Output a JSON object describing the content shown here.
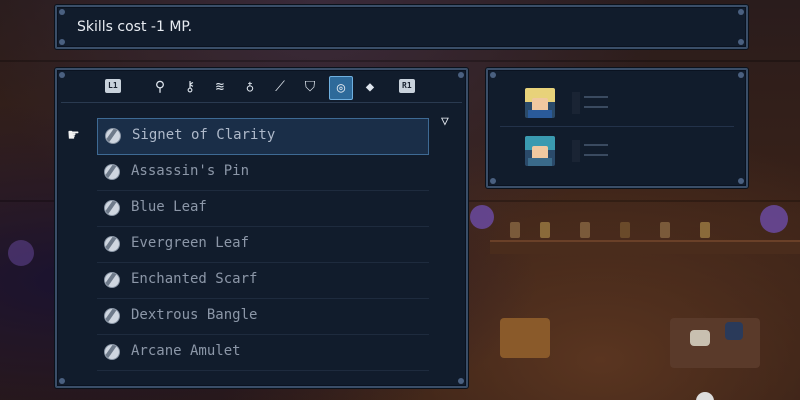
{
  "message": {
    "text": "Skills cost -1 MP."
  },
  "tabs": {
    "left_key": "L1",
    "right_key": "R1",
    "items": [
      {
        "icon": "staff-icon",
        "glyph": "⚲"
      },
      {
        "icon": "key-icon",
        "glyph": "⚷"
      },
      {
        "icon": "scroll-icon",
        "glyph": "≋"
      },
      {
        "icon": "potion-icon",
        "glyph": "♁"
      },
      {
        "icon": "sword-icon",
        "glyph": "⟋"
      },
      {
        "icon": "shield-icon",
        "glyph": "⛉"
      },
      {
        "icon": "ring-icon",
        "glyph": "◎"
      },
      {
        "icon": "gem-icon",
        "glyph": "◆"
      }
    ],
    "active_index": 6
  },
  "inventory": {
    "sort_glyph": "▽",
    "items": [
      {
        "name": "Signet of Clarity",
        "selected": true
      },
      {
        "name": "Assassin's Pin",
        "selected": false
      },
      {
        "name": "Blue Leaf",
        "selected": false
      },
      {
        "name": "Evergreen Leaf",
        "selected": false
      },
      {
        "name": "Enchanted Scarf",
        "selected": false
      },
      {
        "name": "Dextrous Bangle",
        "selected": false
      },
      {
        "name": "Arcane Amulet",
        "selected": false
      }
    ]
  },
  "party": {
    "members": [
      {
        "portrait": "blond-hero-portrait",
        "hair_color": "#e8d27a",
        "body_color": "#2a5a9a"
      },
      {
        "portrait": "hooded-mage-portrait",
        "hair_color": "#3a9ab0",
        "body_color": "#3a6a8a"
      }
    ]
  },
  "colors": {
    "panel_bg": "#111c2c",
    "panel_border": "#3a4e68",
    "active_tab": "#2e6a9a",
    "text_primary": "#e8ecf2",
    "text_item": "#8c97a8"
  }
}
